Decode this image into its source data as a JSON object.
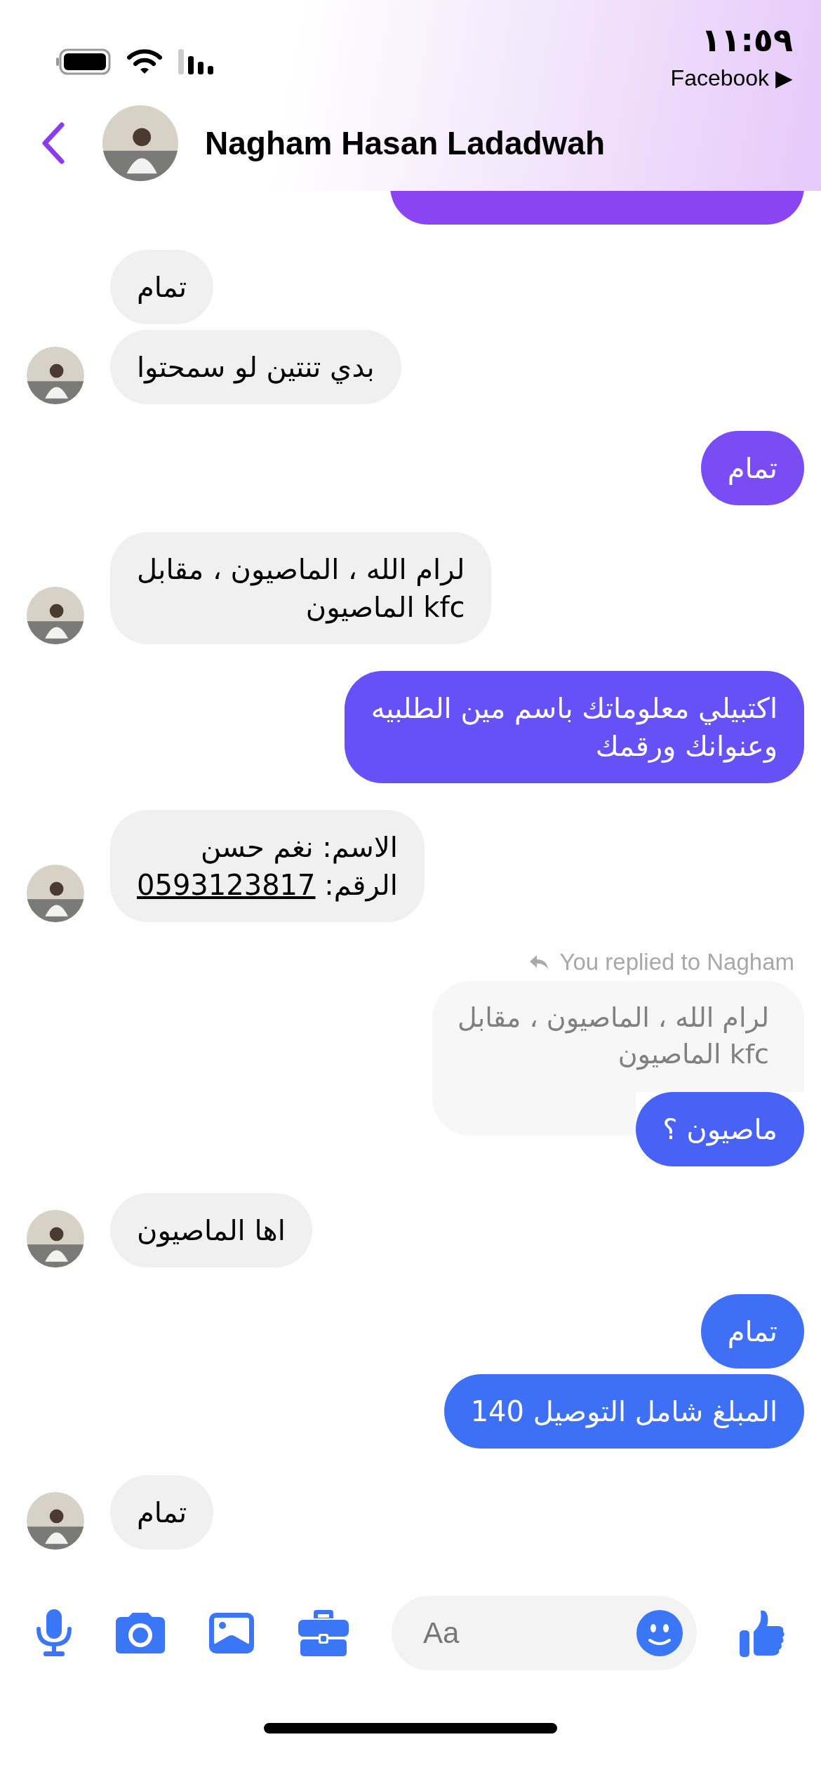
{
  "status_bar": {
    "time": "١١:٥٩",
    "back_to_app": "Facebook ▶"
  },
  "header": {
    "contact_name": "Nagham Hasan Ladadwah"
  },
  "partial_message": {
    "color": "#8a44f2"
  },
  "groups": [
    {
      "kind": "incoming",
      "messages": [
        {
          "text": "تمام"
        },
        {
          "text": "بدي تنتين لو سمحتوا"
        }
      ]
    },
    {
      "kind": "outgoing",
      "messages": [
        {
          "text": "تمام",
          "color": "#7a4cf6"
        }
      ]
    },
    {
      "kind": "incoming",
      "messages": [
        {
          "text": "لرام الله ، الماصيون ، مقابل\nkfc الماصيون"
        }
      ]
    },
    {
      "kind": "outgoing",
      "messages": [
        {
          "text": "اكتبيلي معلوماتك باسم مين الطلبيه\nوعنوانك ورقمك",
          "color": "#6551f6"
        }
      ]
    },
    {
      "kind": "incoming",
      "messages": [
        {
          "text": "الاسم: نغم حسن\nالرقم: ",
          "link": "0593123817"
        }
      ]
    },
    {
      "kind": "outgoing",
      "reply": {
        "label": "You replied to Nagham",
        "quoted": "لرام الله ، الماصيون ، مقابل\nkfc الماصيون"
      },
      "messages": [
        {
          "text": "ماصيون ؟",
          "color": "#4862f5"
        }
      ]
    },
    {
      "kind": "incoming",
      "messages": [
        {
          "text": "اها الماصيون"
        }
      ]
    },
    {
      "kind": "outgoing",
      "messages": [
        {
          "text": "تمام",
          "color": "#3f6ff5"
        },
        {
          "text": "المبلغ شامل التوصيل 140",
          "color": "#3d70f5"
        }
      ]
    },
    {
      "kind": "incoming",
      "messages": [
        {
          "text": "تمام"
        }
      ]
    }
  ],
  "composer": {
    "placeholder": "Aa"
  }
}
